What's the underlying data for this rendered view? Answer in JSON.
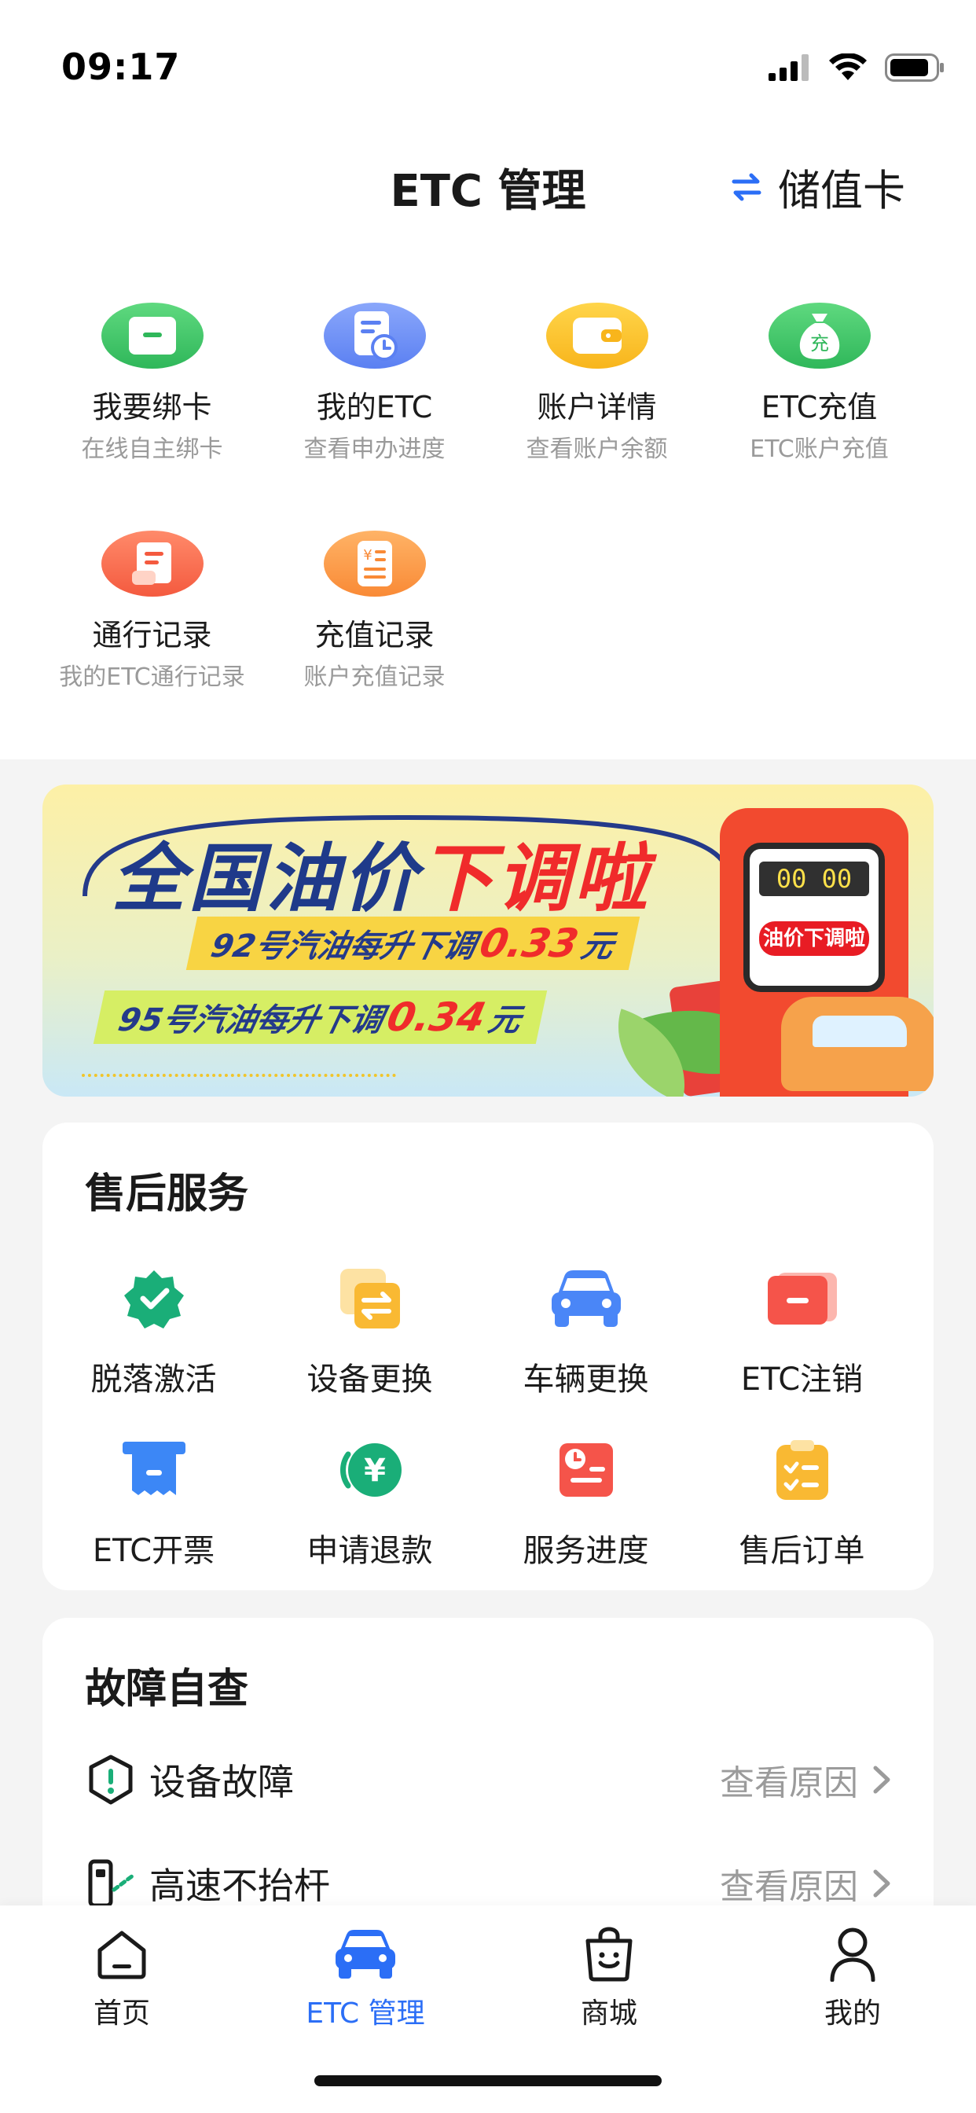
{
  "status_bar": {
    "time": "09:17"
  },
  "header": {
    "title": "ETC 管理",
    "switch_label": "储值卡"
  },
  "top_grid": [
    {
      "label": "我要绑卡",
      "sub": "在线自主绑卡",
      "icon": "card-bind-icon",
      "color": "#3fc46a"
    },
    {
      "label": "我的ETC",
      "sub": "查看申办进度",
      "icon": "document-clock-icon",
      "color": "#6f93f7"
    },
    {
      "label": "账户详情",
      "sub": "查看账户余额",
      "icon": "wallet-icon",
      "color": "#f9c227"
    },
    {
      "label": "ETC充值",
      "sub": "ETC账户充值",
      "icon": "money-bag-icon",
      "color": "#3fc46a"
    },
    {
      "label": "通行记录",
      "sub": "我的ETC通行记录",
      "icon": "scroll-icon",
      "color": "#fa6e52"
    },
    {
      "label": "充值记录",
      "sub": "账户充值记录",
      "icon": "receipt-icon",
      "color": "#fb9a4a"
    }
  ],
  "banner": {
    "title_part1": "全国油价",
    "title_part2": "下调啦",
    "line1_prefix": "92号汽油每升下调",
    "line1_value": "0.33",
    "line1_unit": "元",
    "line2_prefix": "95号汽油每升下调",
    "line2_value": "0.34",
    "line2_unit": "元",
    "pump_digits": "00 00",
    "pump_tag": "油价下调啦"
  },
  "after_sales": {
    "title": "售后服务",
    "items": [
      {
        "label": "脱落激活",
        "icon": "badge-check-icon",
        "color": "#1aae78"
      },
      {
        "label": "设备更换",
        "icon": "swap-device-icon",
        "color": "#f9b933"
      },
      {
        "label": "车辆更换",
        "icon": "car-icon",
        "color": "#4a86f7"
      },
      {
        "label": "ETC注销",
        "icon": "cancel-card-icon",
        "color": "#f5544a"
      },
      {
        "label": "ETC开票",
        "icon": "invoice-icon",
        "color": "#3c87f6"
      },
      {
        "label": "申请退款",
        "icon": "refund-icon",
        "color": "#1aae78"
      },
      {
        "label": "服务进度",
        "icon": "progress-icon",
        "color": "#f5544a"
      },
      {
        "label": "售后订单",
        "icon": "clipboard-icon",
        "color": "#f9b933"
      }
    ]
  },
  "fault_check": {
    "title": "故障自查",
    "items": [
      {
        "label": "设备故障",
        "link": "查看原因",
        "icon": "shield-alert-icon"
      },
      {
        "label": "高速不抬杆",
        "link": "查看原因",
        "icon": "toll-gate-icon"
      }
    ]
  },
  "tab_bar": [
    {
      "label": "首页",
      "icon": "home-icon",
      "active": false
    },
    {
      "label": "ETC 管理",
      "icon": "car-icon",
      "active": true
    },
    {
      "label": "商城",
      "icon": "shopping-bag-icon",
      "active": false
    },
    {
      "label": "我的",
      "icon": "user-icon",
      "active": false
    }
  ],
  "colors": {
    "accent": "#2b6ef6",
    "text": "#1c1c1c",
    "muted": "#9a9a9a",
    "background": "#f4f4f4"
  }
}
